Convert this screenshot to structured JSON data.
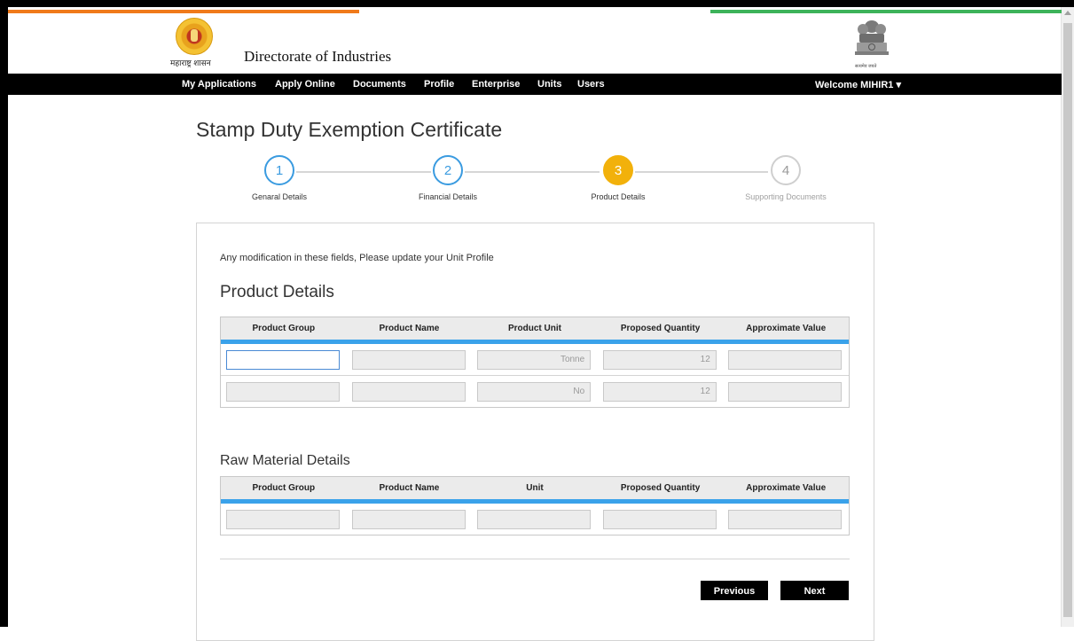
{
  "colors": {
    "saffron": "#f07a1a",
    "white": "#ffffff",
    "green": "#3db35a",
    "accent": "#3aa2ea",
    "active_step": "#f2b10b"
  },
  "header": {
    "state_caption": "महाराष्ट्र शासन",
    "title": "Directorate of Industries",
    "emblem_caption": "सत्यमेव जयते"
  },
  "nav": {
    "items": [
      "My Applications",
      "Apply Online",
      "Documents",
      "Profile",
      "Enterprise",
      "Units",
      "Users"
    ],
    "welcome": "Welcome MIHIR1 ▾"
  },
  "page": {
    "title": "Stamp Duty Exemption Certificate"
  },
  "wizard": {
    "steps": [
      {
        "number": "1",
        "label": "Genaral Details",
        "state": "done"
      },
      {
        "number": "2",
        "label": "Financial Details",
        "state": "done"
      },
      {
        "number": "3",
        "label": "Product Details",
        "state": "active"
      },
      {
        "number": "4",
        "label": "Supporting Documents",
        "state": "todo"
      }
    ]
  },
  "form": {
    "note": "Any modification in these fields, Please update your Unit Profile",
    "product_section": {
      "title": "Product Details",
      "headers": [
        "Product Group",
        "Product Name",
        "Product Unit",
        "Proposed Quantity",
        "Approximate Value"
      ],
      "rows": [
        [
          "",
          "",
          "Tonne",
          "12",
          ""
        ],
        [
          "",
          "",
          "No",
          "12",
          ""
        ]
      ]
    },
    "raw_section": {
      "title": "Raw Material Details",
      "headers": [
        "Product Group",
        "Product Name",
        "Unit",
        "Proposed Quantity",
        "Approximate Value"
      ],
      "rows": [
        [
          "",
          "",
          "",
          "",
          ""
        ]
      ]
    },
    "buttons": {
      "previous": "Previous",
      "next": "Next"
    }
  }
}
